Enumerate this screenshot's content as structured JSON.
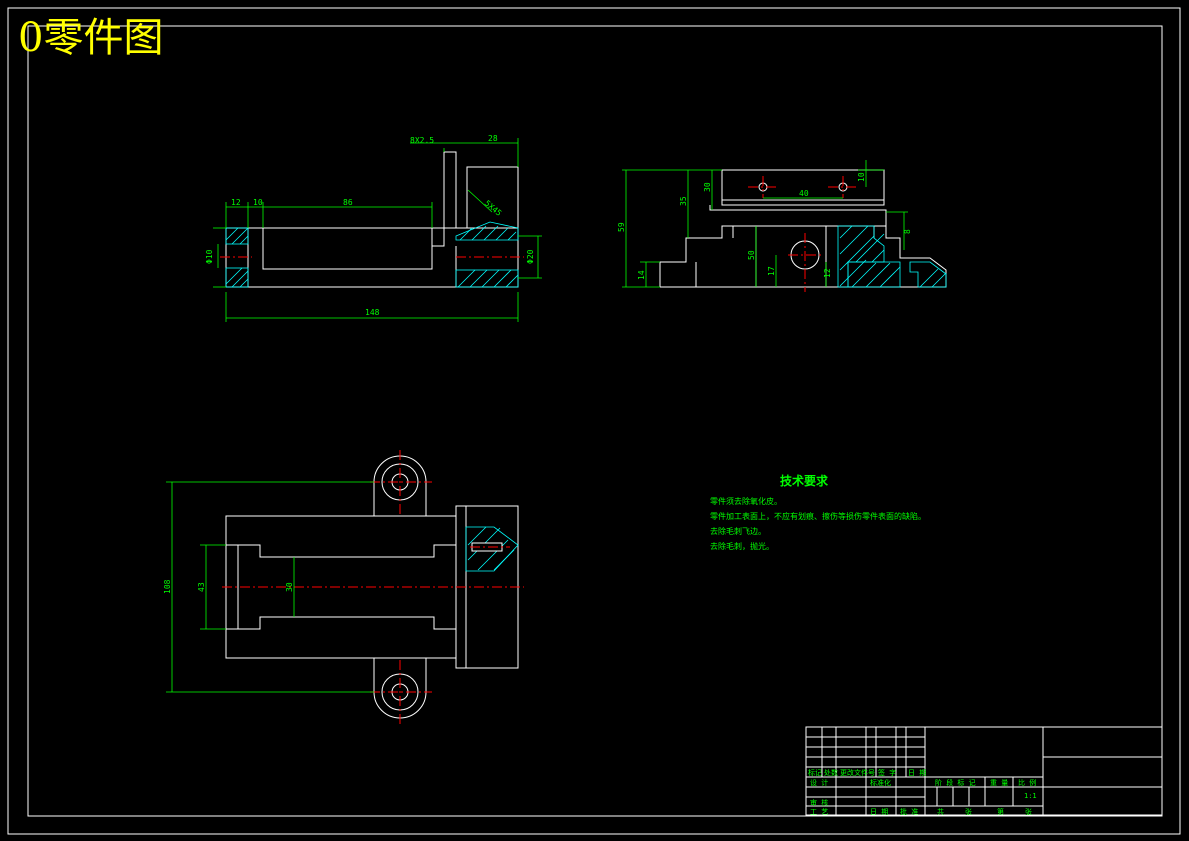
{
  "drawing_title": "0零件图",
  "tech_requirements": {
    "title": "技术要求",
    "lines": [
      "零件须去除氧化皮。",
      "零件加工表面上，不应有划痕、擦伤等损伤零件表面的缺陷。",
      "去除毛刺飞边。",
      "去除毛刺，抛光。"
    ]
  },
  "dimensions": {
    "chamfer": "8X2.5",
    "dim_28": "28",
    "dim_12": "12",
    "dim_10": "10",
    "dim_86": "86",
    "dim_phi10": "Φ10",
    "dim_phi20": "Φ20",
    "dim_148": "148",
    "dim_5x45": "5X45",
    "side_59": "59",
    "side_35": "35",
    "side_30": "30",
    "side_40": "40",
    "side_10": "10",
    "side_8": "8",
    "side_50": "50",
    "side_17": "17",
    "side_12": "12",
    "side_14": "14",
    "top_108": "108",
    "top_43": "43",
    "top_30": "30"
  },
  "title_block": {
    "sign_labels": [
      "标记",
      "处数",
      "更改文件号",
      "签 字",
      "日 期"
    ],
    "designer": "设 计",
    "standardize": "标准化",
    "approve": "批 准",
    "review": "审 核",
    "process": "工 艺",
    "date": "日 期",
    "stage_labels": [
      "阶 段 标 记",
      "重 量",
      "比 例"
    ],
    "scale": "1:1",
    "sheets": [
      "共",
      "张",
      "第",
      "张"
    ]
  },
  "colors": {
    "frame": "#ffffff",
    "dimension": "#00ff00",
    "centerline": "#ff0000",
    "hatch": "#00ffff",
    "title_text": "#ffff00",
    "tech_text": "#00ff00"
  }
}
